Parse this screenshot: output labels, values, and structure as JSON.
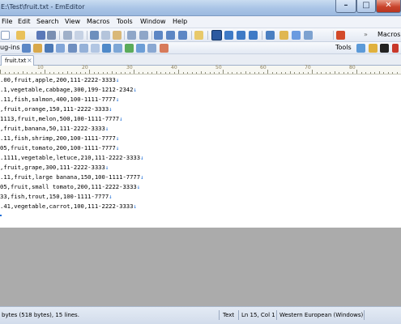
{
  "window": {
    "title": "E:\\Test\\fruit.txt - EmEditor"
  },
  "menu": {
    "items": [
      "File",
      "Edit",
      "Search",
      "View",
      "Macros",
      "Tools",
      "Window",
      "Help"
    ]
  },
  "toolbar": {
    "macros_label": "Macros",
    "plugins_label": "ug-ins",
    "tools_label": "Tools"
  },
  "tab": {
    "label": "fruit.txt",
    "close": "×"
  },
  "ruler": {
    "marks": [
      "10",
      "20",
      "30",
      "40",
      "50",
      "60",
      "70",
      "80"
    ]
  },
  "editor": {
    "lines": [
      ".00,fruit,apple,200,111-2222-3333",
      ".1,vegetable,cabbage,300,199-1212-2342",
      ".11,fish,salmon,400,100-1111-7777",
      ",fruit,orange,150,111-2222-3333",
      "1113,fruit,melon,500,100-1111-7777",
      ",fruit,banana,50,111-2222-3333",
      ".11,fish,shrimp,200,100-1111-7777",
      "05,fruit,tomato,200,100-1111-7777",
      ".1111,vegetable,letuce,210,111-2222-3333",
      ",fruit,grape,300,111-2222-3333",
      ".11,fruit,large banana,150,100-1111-7777",
      "05,fruit,small tomato,200,111-2222-3333",
      "33,fish,trout,150,100-1111-7777",
      ".41,vegetable,carrot,100,111-2222-3333"
    ],
    "eol_mark": "↓"
  },
  "status": {
    "info": "bytes (518 bytes), 15 lines.",
    "mode": "Text",
    "position": "Ln 15, Col 1",
    "encoding": "Western European (Windows)"
  }
}
